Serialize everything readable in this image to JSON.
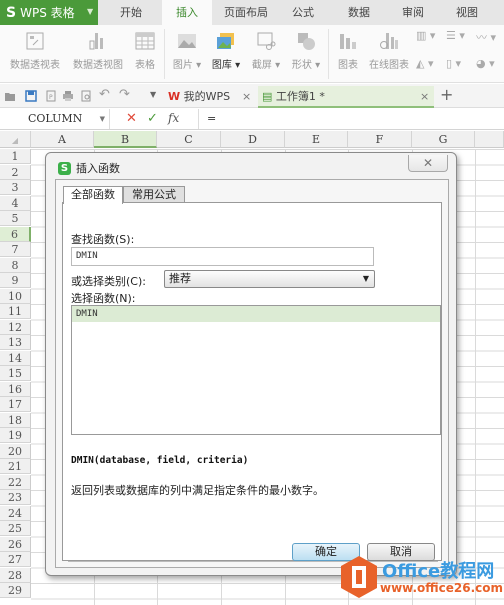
{
  "app": {
    "logo": "S",
    "title": "WPS 表格"
  },
  "menu_tabs": [
    {
      "label": "开始",
      "active": false
    },
    {
      "label": "插入",
      "active": true
    },
    {
      "label": "页面布局",
      "active": false
    },
    {
      "label": "公式",
      "active": false
    },
    {
      "label": "数据",
      "active": false
    },
    {
      "label": "审阅",
      "active": false
    },
    {
      "label": "视图",
      "active": false
    }
  ],
  "ribbon": {
    "pivot_table": "数据透视表",
    "pivot_chart": "数据透视图",
    "table": "表格",
    "picture": "图片",
    "gallery": "图库",
    "screenshot": "截屏",
    "shapes": "形状",
    "chart": "图表",
    "online_chart": "在线图表"
  },
  "doc_tabs": [
    {
      "label": "我的WPS",
      "active": false
    },
    {
      "label": "工作簿1 *",
      "active": true
    }
  ],
  "formula_bar": {
    "name_box": "COLUMN",
    "cancel": "✕",
    "confirm": "✓",
    "fx": "fx",
    "content": "="
  },
  "grid": {
    "columns": [
      "A",
      "B",
      "C",
      "D",
      "E",
      "F",
      "G"
    ],
    "selected_column": "B",
    "rows": [
      "1",
      "2",
      "3",
      "4",
      "5",
      "6",
      "7",
      "8",
      "9",
      "10",
      "11",
      "12",
      "13",
      "14",
      "15",
      "16",
      "17",
      "18",
      "19",
      "20",
      "21",
      "22",
      "23",
      "24",
      "25",
      "26",
      "27",
      "28",
      "29"
    ],
    "selected_row": "6"
  },
  "dialog": {
    "logo": "S",
    "title": "插入函数",
    "close": "✕",
    "tabs": [
      {
        "label": "全部函数",
        "active": true
      },
      {
        "label": "常用公式",
        "active": false
      }
    ],
    "search_label": "查找函数(S):",
    "search_value": "DMIN",
    "category_label": "或选择类别(C):",
    "category_value": "推荐",
    "function_label": "选择函数(N):",
    "functions": [
      {
        "name": "DMIN",
        "selected": true
      }
    ],
    "syntax": "DMIN(database, field, criteria)",
    "description": "返回列表或数据库的列中满足指定条件的最小数字。",
    "ok": "确定",
    "cancel": "取消"
  },
  "watermark": {
    "title": "Office教程网",
    "url": "www.office26.com",
    "colors": {
      "blue": "#3b9be0",
      "orange": "#e8622a"
    }
  },
  "colors": {
    "accent_green": "#4b9a3a",
    "selection_green": "#dcebd4"
  }
}
